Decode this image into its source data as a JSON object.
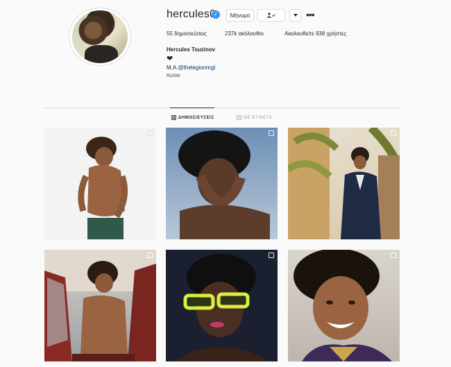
{
  "profile": {
    "username": "hercules0",
    "message_button": "Μήνυμα",
    "stats": {
      "posts": "55 δημοσιεύσεις",
      "followers": "237k ακόλουθοι",
      "following": "Ακολουθείτε 938 χρήστες"
    },
    "full_name": "Hercules Tsuzinov",
    "bio_heart": "❤",
    "bio_prefix": "M.A.",
    "bio_mention": "@thelegionmgt",
    "bio_location": "RU/GN"
  },
  "tabs": [
    {
      "label": "ΔΗΜΟΣΙΕΥΣΕΙΣ",
      "active": true
    },
    {
      "label": "ΜΕ ΕΤΙΚΕΤΑ",
      "active": false
    }
  ],
  "icons": {
    "verified": "verified-badge-icon",
    "follow": "person-check-icon",
    "dropdown": "chevron-down-icon",
    "more": "more-horizontal-icon",
    "grid": "grid-icon",
    "tagged": "tag-icon"
  },
  "colors": {
    "verified": "#3897f0",
    "mention": "#003569",
    "background": "#fafafa",
    "border": "#dbdbdb"
  },
  "posts": [
    {
      "id": 1,
      "type": "image"
    },
    {
      "id": 2,
      "type": "image"
    },
    {
      "id": 3,
      "type": "image"
    },
    {
      "id": 4,
      "type": "image"
    },
    {
      "id": 5,
      "type": "image"
    },
    {
      "id": 6,
      "type": "image"
    }
  ]
}
